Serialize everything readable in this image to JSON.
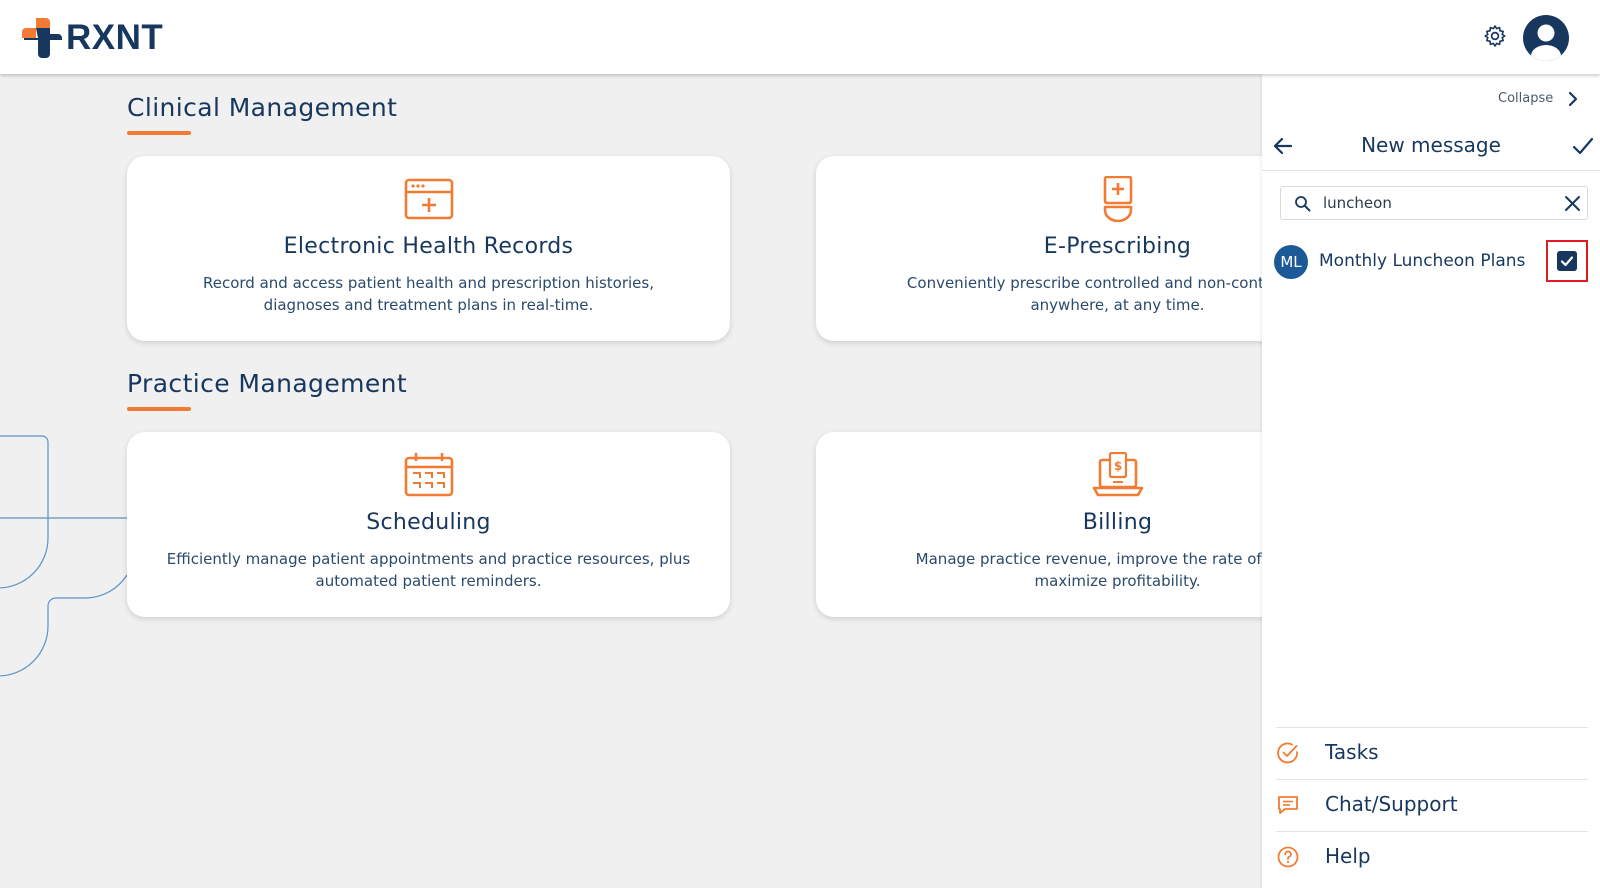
{
  "header": {
    "logo_text": "RXNT",
    "icons": {
      "settings": "gear-icon",
      "profile": "user-avatar-icon"
    }
  },
  "colors": {
    "brand_navy": "#17375e",
    "accent_orange": "#f37a33",
    "badge_blue": "#1b5a96",
    "highlight_red": "#e31b23"
  },
  "clinical": {
    "title": "Clinical Management",
    "cards": [
      {
        "title": "Electronic Health Records",
        "desc1": "Record and access patient health and prescription histories,",
        "desc2": "diagnoses and treatment plans in real-time.",
        "icon": "ehr-calendar-plus-icon"
      },
      {
        "title": "E-Prescribing",
        "desc1": "Conveniently prescribe controlled and non-controlled su",
        "desc2": "anywhere, at any time.",
        "icon": "prescription-bottle-icon"
      }
    ]
  },
  "practice": {
    "title": "Practice Management",
    "cards": [
      {
        "title": "Scheduling",
        "desc1": "Efficiently manage patient appointments and practice resources, plus",
        "desc2": "automated patient reminders.",
        "icon": "calendar-icon"
      },
      {
        "title": "Billing",
        "desc1": "Manage practice revenue, improve the rate of reimbu",
        "desc2": "maximize profitability.",
        "icon": "billing-laptop-icon"
      }
    ]
  },
  "panel": {
    "collapse_label": "Collapse",
    "title": "New message",
    "search": {
      "value": "luncheon",
      "placeholder": ""
    },
    "contact": {
      "initials": "ML",
      "name": "Monthly Luncheon Plans",
      "selected": true
    },
    "nav": [
      {
        "label": "Tasks",
        "icon": "tasks-check-circle-icon"
      },
      {
        "label": "Chat/Support",
        "icon": "chat-bubble-icon"
      },
      {
        "label": "Help",
        "icon": "help-circle-icon"
      }
    ]
  }
}
